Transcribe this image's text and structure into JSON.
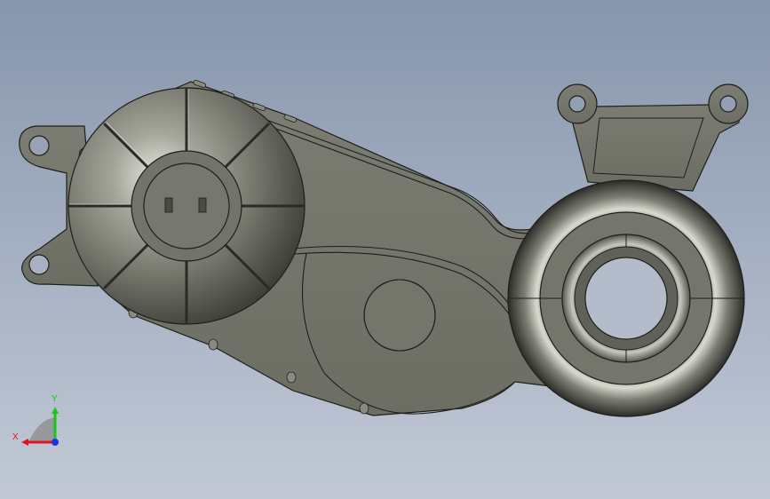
{
  "viewport": {
    "background_top": "#8796ad",
    "background_bottom": "#c2c9d6"
  },
  "model": {
    "body_color": "#74756b",
    "edge_color": "#1e1f1a"
  },
  "triad": {
    "x_label": "X",
    "y_label": "Y",
    "x_color": "#e0141e",
    "y_color": "#19c619",
    "z_color": "#1e32e6"
  }
}
